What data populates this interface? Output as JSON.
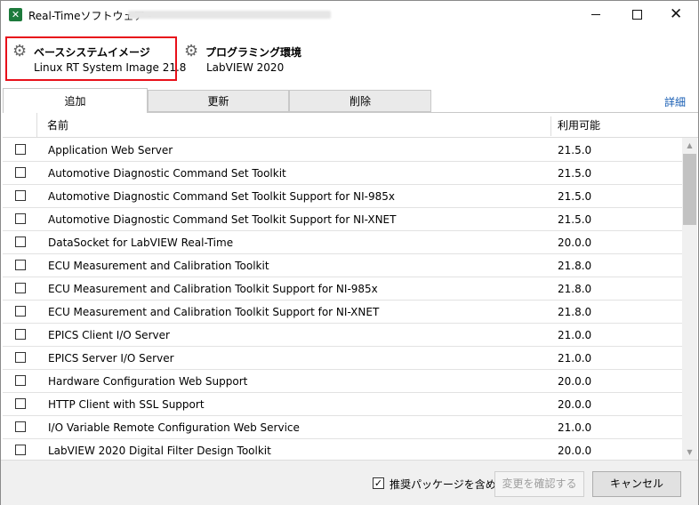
{
  "window": {
    "title": "Real-Timeソフトウェア -",
    "controls": {
      "minimize": "minimize-icon",
      "maximize": "maximize-icon",
      "close": "close-icon"
    }
  },
  "header": {
    "base_image": {
      "title": "ベースシステムイメージ",
      "value": "Linux RT System Image 21.8",
      "icon": "gear-icon"
    },
    "programming": {
      "title": "プログラミング環境",
      "value": "LabVIEW 2020",
      "icon": "gear-icon"
    }
  },
  "tabs": [
    {
      "label": "追加",
      "active": true
    },
    {
      "label": "更新",
      "active": false
    },
    {
      "label": "削除",
      "active": false
    }
  ],
  "details_link": "詳細",
  "table": {
    "columns": {
      "name": "名前",
      "version": "利用可能"
    },
    "rows": [
      {
        "name": "Application Web Server",
        "version": "21.5.0"
      },
      {
        "name": "Automotive Diagnostic Command Set Toolkit",
        "version": "21.5.0"
      },
      {
        "name": "Automotive Diagnostic Command Set Toolkit Support for NI-985x",
        "version": "21.5.0"
      },
      {
        "name": "Automotive Diagnostic Command Set Toolkit Support for NI-XNET",
        "version": "21.5.0"
      },
      {
        "name": "DataSocket for LabVIEW Real-Time",
        "version": "20.0.0"
      },
      {
        "name": "ECU Measurement and Calibration Toolkit",
        "version": "21.8.0"
      },
      {
        "name": "ECU Measurement and Calibration Toolkit Support for NI-985x",
        "version": "21.8.0"
      },
      {
        "name": "ECU Measurement and Calibration Toolkit Support for NI-XNET",
        "version": "21.8.0"
      },
      {
        "name": "EPICS Client I/O Server",
        "version": "21.0.0"
      },
      {
        "name": "EPICS Server I/O Server",
        "version": "21.0.0"
      },
      {
        "name": "Hardware Configuration Web Support",
        "version": "20.0.0"
      },
      {
        "name": "HTTP Client with SSL Support",
        "version": "20.0.0"
      },
      {
        "name": "I/O Variable Remote Configuration Web Service",
        "version": "21.0.0"
      },
      {
        "name": "LabVIEW 2020 Digital Filter Design Toolkit",
        "version": "20.0.0"
      }
    ]
  },
  "footer": {
    "include_recommended_label": "推奨パッケージを含める",
    "include_recommended_checked": true,
    "confirm_button": "変更を確認する",
    "cancel_button": "キャンセル"
  },
  "colors": {
    "highlight_border": "#e8101a",
    "link": "#1a5fb4",
    "app_icon": "#1d7a3c"
  }
}
